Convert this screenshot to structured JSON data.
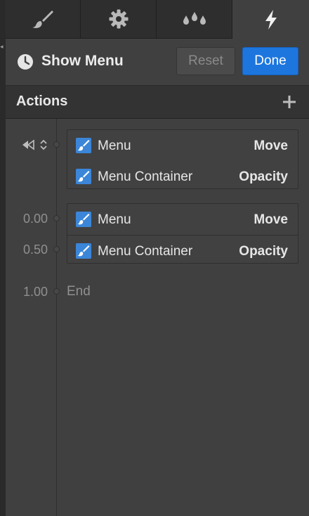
{
  "colors": {
    "panel": "#404040",
    "tabbar": "#2e2e2e",
    "accent": "#1d76de",
    "checkbox": "#3b86d8"
  },
  "tabs": [
    {
      "icon": "brush-icon",
      "active": false
    },
    {
      "icon": "gear-icon",
      "active": false
    },
    {
      "icon": "drops-icon",
      "active": false
    },
    {
      "icon": "lightning-icon",
      "active": true
    }
  ],
  "header": {
    "title": "Show Menu",
    "icon": "clock-icon",
    "reset_label": "Reset",
    "done_label": "Done"
  },
  "actions": {
    "label": "Actions",
    "add_icon": "plus-icon"
  },
  "trigger_group": {
    "icons": [
      "rewind-icon",
      "updown-icon"
    ],
    "rows": [
      {
        "target": "Menu",
        "action": "Move"
      },
      {
        "target": "Menu Container",
        "action": "Opacity"
      }
    ]
  },
  "timed_group": {
    "rows": [
      {
        "time": "0.00",
        "target": "Menu",
        "action": "Move"
      },
      {
        "time": "0.50",
        "target": "Menu Container",
        "action": "Opacity"
      }
    ]
  },
  "end": {
    "time": "1.00",
    "label": "End"
  }
}
